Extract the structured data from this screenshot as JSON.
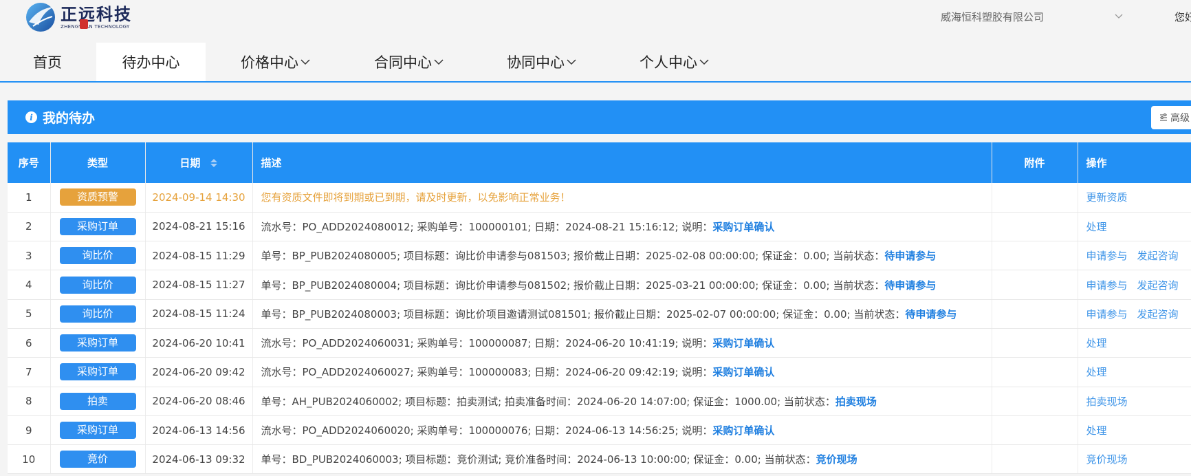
{
  "header": {
    "logo_cn": "正远科技",
    "logo_en": "ZHENGYUAN TECHNOLOGY",
    "company": "威海恒科塑胶有限公司",
    "greeting": "您好"
  },
  "nav": [
    {
      "label": "首页",
      "active": false,
      "dropdown": false
    },
    {
      "label": "待办中心",
      "active": true,
      "dropdown": false
    },
    {
      "label": "价格中心",
      "active": false,
      "dropdown": true
    },
    {
      "label": "合同中心",
      "active": false,
      "dropdown": true
    },
    {
      "label": "协同中心",
      "active": false,
      "dropdown": true
    },
    {
      "label": "个人中心",
      "active": false,
      "dropdown": true
    }
  ],
  "panel": {
    "title": "我的待办",
    "advanced_button": "高级"
  },
  "table": {
    "columns": [
      "序号",
      "类型",
      "日期",
      "描述",
      "附件",
      "操作"
    ],
    "rows": [
      {
        "no": "1",
        "type": "资质预警",
        "type_color": "#e6a23c",
        "date": "2024-09-14 14:30",
        "warn": true,
        "desc_prefix": "您有资质文件即将到期或已到期，请及时更新，以免影响正常业务！",
        "desc_kw": "",
        "actions": [
          "更新资质"
        ]
      },
      {
        "no": "2",
        "type": "采购订单",
        "type_color": "#2f8ff0",
        "date": "2024-08-21 15:16",
        "warn": false,
        "desc_prefix": "流水号：PO_ADD2024080012; 采购单号：100000101; 日期：2024-08-21 15:16:12; 说明：",
        "desc_kw": "采购订单确认",
        "actions": [
          "处理"
        ]
      },
      {
        "no": "3",
        "type": "询比价",
        "type_color": "#2f8ff0",
        "date": "2024-08-15 11:29",
        "warn": false,
        "desc_prefix": "单号：BP_PUB2024080005; 项目标题：询比价申请参与081503; 报价截止日期：2025-02-08 00:00:00; 保证金：0.00; 当前状态：",
        "desc_kw": "待申请参与",
        "actions": [
          "申请参与",
          "发起咨询"
        ]
      },
      {
        "no": "4",
        "type": "询比价",
        "type_color": "#2f8ff0",
        "date": "2024-08-15 11:27",
        "warn": false,
        "desc_prefix": "单号：BP_PUB2024080004; 项目标题：询比价申请参与081502; 报价截止日期：2025-03-21 00:00:00; 保证金：0.00; 当前状态：",
        "desc_kw": "待申请参与",
        "actions": [
          "申请参与",
          "发起咨询"
        ]
      },
      {
        "no": "5",
        "type": "询比价",
        "type_color": "#2f8ff0",
        "date": "2024-08-15 11:24",
        "warn": false,
        "desc_prefix": "单号：BP_PUB2024080003; 项目标题：询比价项目邀请测试081501; 报价截止日期：2025-02-07 00:00:00; 保证金：0.00; 当前状态：",
        "desc_kw": "待申请参与",
        "actions": [
          "申请参与",
          "发起咨询"
        ]
      },
      {
        "no": "6",
        "type": "采购订单",
        "type_color": "#2f8ff0",
        "date": "2024-06-20 10:41",
        "warn": false,
        "desc_prefix": "流水号：PO_ADD2024060031; 采购单号：100000087; 日期：2024-06-20 10:41:19; 说明：",
        "desc_kw": "采购订单确认",
        "actions": [
          "处理"
        ]
      },
      {
        "no": "7",
        "type": "采购订单",
        "type_color": "#2f8ff0",
        "date": "2024-06-20 09:42",
        "warn": false,
        "desc_prefix": "流水号：PO_ADD2024060027; 采购单号：100000083; 日期：2024-06-20 09:42:19; 说明：",
        "desc_kw": "采购订单确认",
        "actions": [
          "处理"
        ]
      },
      {
        "no": "8",
        "type": "拍卖",
        "type_color": "#2f8ff0",
        "date": "2024-06-20 08:46",
        "warn": false,
        "desc_prefix": "单号：AH_PUB2024060002; 项目标题：拍卖测试; 拍卖准备时间：2024-06-20 14:07:00; 保证金：1000.00; 当前状态：",
        "desc_kw": "拍卖现场",
        "actions": [
          "拍卖现场"
        ]
      },
      {
        "no": "9",
        "type": "采购订单",
        "type_color": "#2f8ff0",
        "date": "2024-06-13 14:56",
        "warn": false,
        "desc_prefix": "流水号：PO_ADD2024060020; 采购单号：100000076; 日期：2024-06-13 14:56:25; 说明：",
        "desc_kw": "采购订单确认",
        "actions": [
          "处理"
        ]
      },
      {
        "no": "10",
        "type": "竞价",
        "type_color": "#2f8ff0",
        "date": "2024-06-13 09:32",
        "warn": false,
        "desc_prefix": "单号：BD_PUB2024060003; 项目标题：竞价测试; 竞价准备时间：2024-06-13 10:00:00; 保证金：0.00; 当前状态：",
        "desc_kw": "竞价现场",
        "actions": [
          "竞价现场"
        ]
      }
    ]
  },
  "colors": {
    "primary": "#2290f5",
    "warning": "#e6a23c",
    "badge_blue": "#2f8ff0",
    "link": "#3d94e8"
  },
  "icons": [
    "logo-icon",
    "chevron-down-icon",
    "info-icon",
    "filter-icon",
    "sort-icon"
  ]
}
